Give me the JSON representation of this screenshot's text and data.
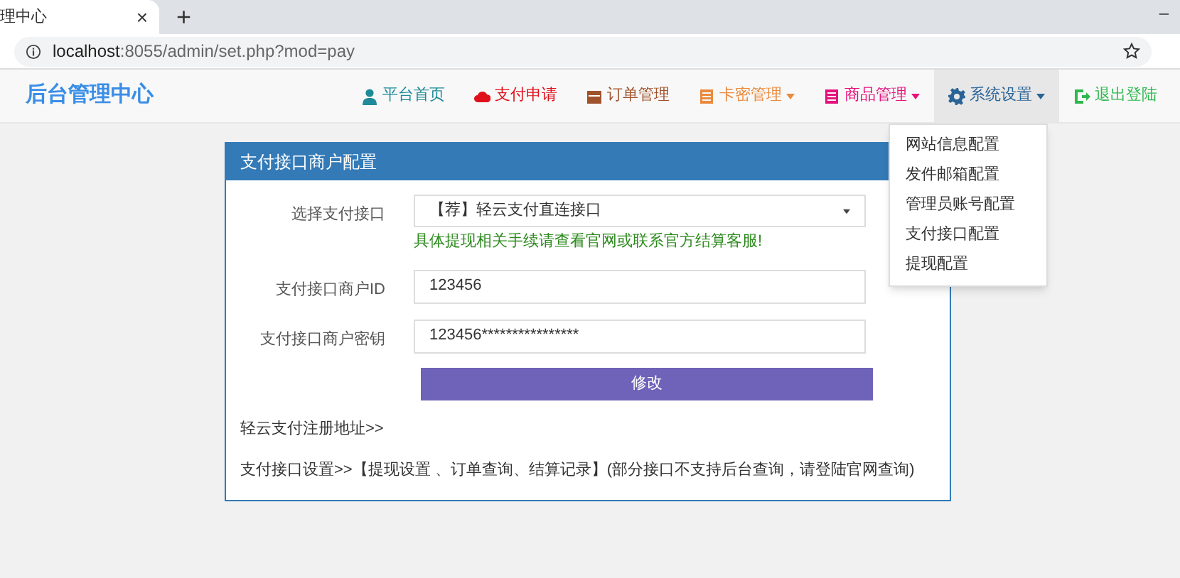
{
  "browser": {
    "tab_title": "理中心",
    "close": "×",
    "new_tab": "+",
    "minimize": "–",
    "url_host": "localhost",
    "url_rest": ":8055/admin/set.php?mod=pay"
  },
  "navbar": {
    "brand": "后台管理中心",
    "items": [
      {
        "label": "平台首页",
        "color": "#1f8a99",
        "dropdown": false,
        "selected": false
      },
      {
        "label": "支付申请",
        "color": "#e0101a",
        "dropdown": false,
        "selected": false
      },
      {
        "label": "订单管理",
        "color": "#a0522d",
        "dropdown": false,
        "selected": false
      },
      {
        "label": "卡密管理",
        "color": "#ea8a3c",
        "dropdown": true,
        "selected": false
      },
      {
        "label": "商品管理",
        "color": "#e5127d",
        "dropdown": true,
        "selected": false
      },
      {
        "label": "系统设置",
        "color": "#2a6496",
        "dropdown": true,
        "selected": true,
        "menu": [
          "网站信息配置",
          "发件邮箱配置",
          "管理员账号配置",
          "支付接口配置",
          "提现配置"
        ]
      },
      {
        "label": "退出登陆",
        "color": "#2fb84f",
        "dropdown": false,
        "selected": false
      }
    ]
  },
  "panel": {
    "title": "支付接口商户配置",
    "select": {
      "label": "选择支付接口",
      "value": "【荐】轻云支付直连接口",
      "hint": "具体提现相关手续请查看官网或联系官方结算客服!"
    },
    "fields": [
      {
        "label": "支付接口商户ID",
        "value": "123456"
      },
      {
        "label": "支付接口商户密钥",
        "value": "123456****************"
      }
    ],
    "submit": "修改",
    "register_link": "轻云支付注册地址>>",
    "settings_link": "支付接口设置>>【提现设置 、订单查询、结算记录】(部分接口不支持后台查询，请登陆官网查询)"
  }
}
